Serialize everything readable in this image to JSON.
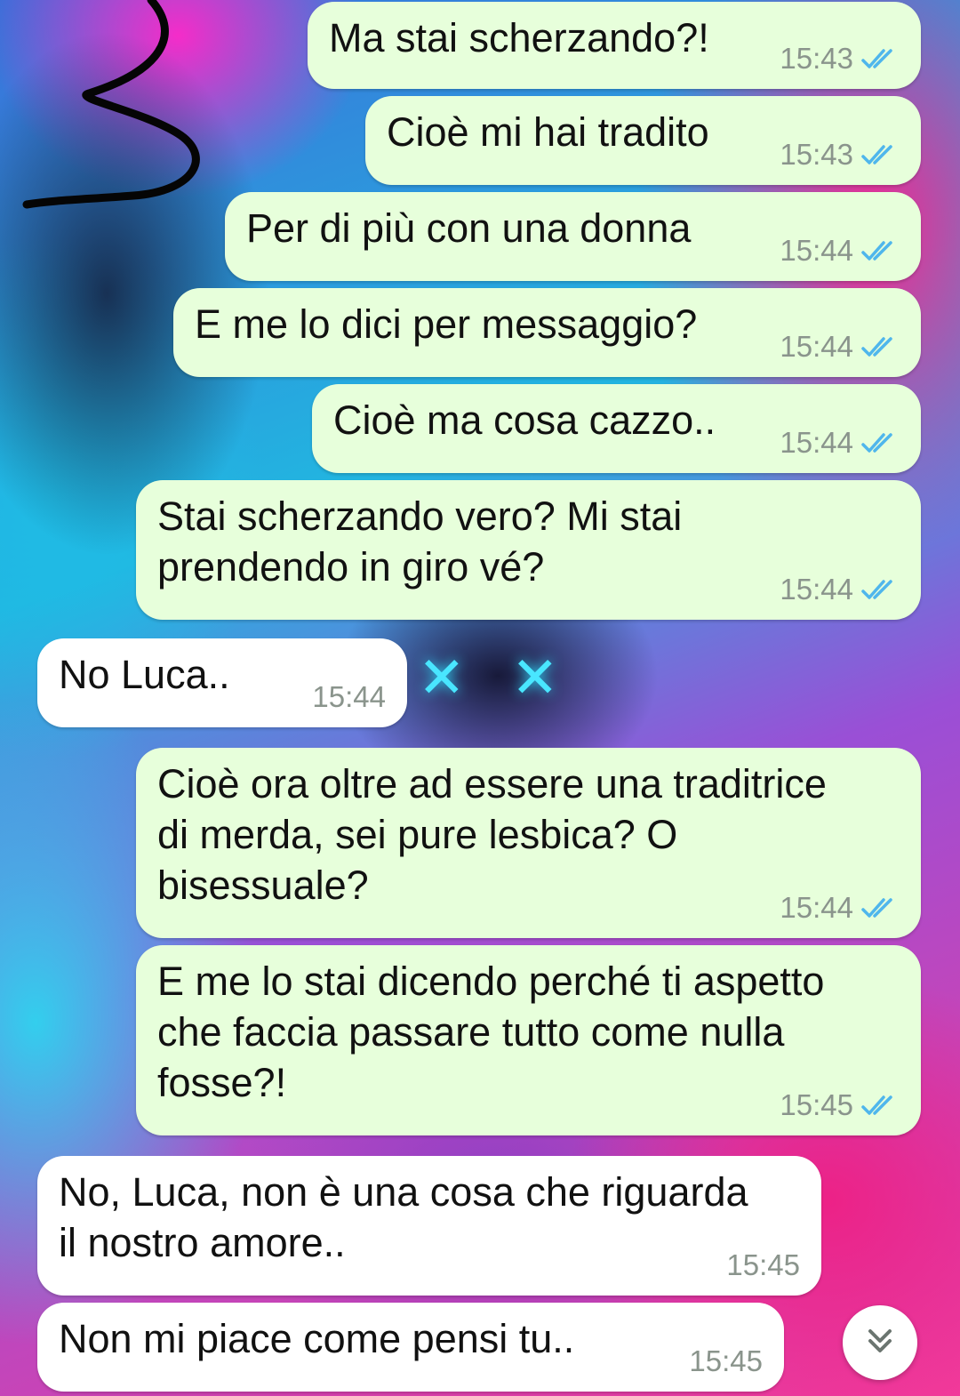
{
  "chat": {
    "messages": [
      {
        "direction": "out",
        "text": "Ma stai scherzando?!",
        "time": "15:43",
        "status": "read"
      },
      {
        "direction": "out",
        "text": "Cioè mi hai tradito",
        "time": "15:43",
        "status": "read"
      },
      {
        "direction": "out",
        "text": "Per di più con una donna",
        "time": "15:44",
        "status": "read"
      },
      {
        "direction": "out",
        "text": "E me lo dici per messaggio?",
        "time": "15:44",
        "status": "read"
      },
      {
        "direction": "out",
        "text": "Cioè ma cosa cazzo..",
        "time": "15:44",
        "status": "read"
      },
      {
        "direction": "out",
        "text": "Stai scherzando vero? Mi stai\nprendendo in giro vé?",
        "time": "15:44",
        "status": "read"
      },
      {
        "direction": "in",
        "text": "No Luca..",
        "time": "15:44"
      },
      {
        "direction": "out",
        "text": "Cioè ora oltre ad essere una traditrice\ndi merda, sei pure lesbica? O\nbisessuale?",
        "time": "15:44",
        "status": "read"
      },
      {
        "direction": "out",
        "text": "E me lo stai dicendo perché ti aspetto\nche faccia passare tutto come nulla\nfosse?!",
        "time": "15:45",
        "status": "read"
      },
      {
        "direction": "in",
        "text": "No, Luca, non è una cosa che riguarda\nil nostro amore..",
        "time": "15:45"
      },
      {
        "direction": "in",
        "text": "Non mi piace come pensi tu..",
        "time": "15:45"
      }
    ]
  },
  "icons": {
    "read_ticks": "double-check-icon",
    "scroll_down": "double-chevron-down-icon"
  },
  "colors": {
    "outgoing_bubble": "#e7ffdb",
    "incoming_bubble": "#ffffff",
    "read_ticks": "#4fb6ec",
    "timestamp": "#8a948c"
  }
}
